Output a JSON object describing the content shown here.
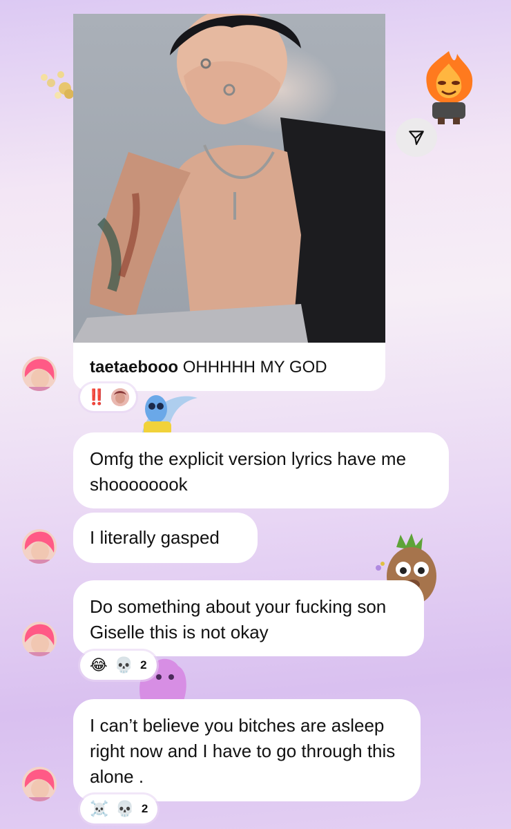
{
  "shared_post": {
    "username": "taetaebooo",
    "caption": "OHHHHH MY GOD"
  },
  "share_button": {
    "icon": "paper-plane-icon"
  },
  "reactions": {
    "post": {
      "emoji": "‼️"
    },
    "message_3": {
      "emoji_1": "😂",
      "emoji_2": "💀",
      "count": "2"
    },
    "message_4": {
      "emoji_1": "☠️",
      "emoji_2": "💀",
      "count": "2"
    }
  },
  "messages": [
    {
      "text": "Omfg the explicit version lyrics have me shoooooook"
    },
    {
      "text": "I literally gasped"
    },
    {
      "text": "Do something about your fucking son Giselle this is not okay"
    },
    {
      "text": "I can’t believe you bitches are asleep right now and I have to go through this alone ."
    }
  ],
  "colors": {
    "bubble": "#ffffff",
    "background_top": "#dcc9f3",
    "background_bottom": "#e3cff3",
    "avatar_hair": "#ff5a86",
    "reaction_red": "#e0245e"
  }
}
